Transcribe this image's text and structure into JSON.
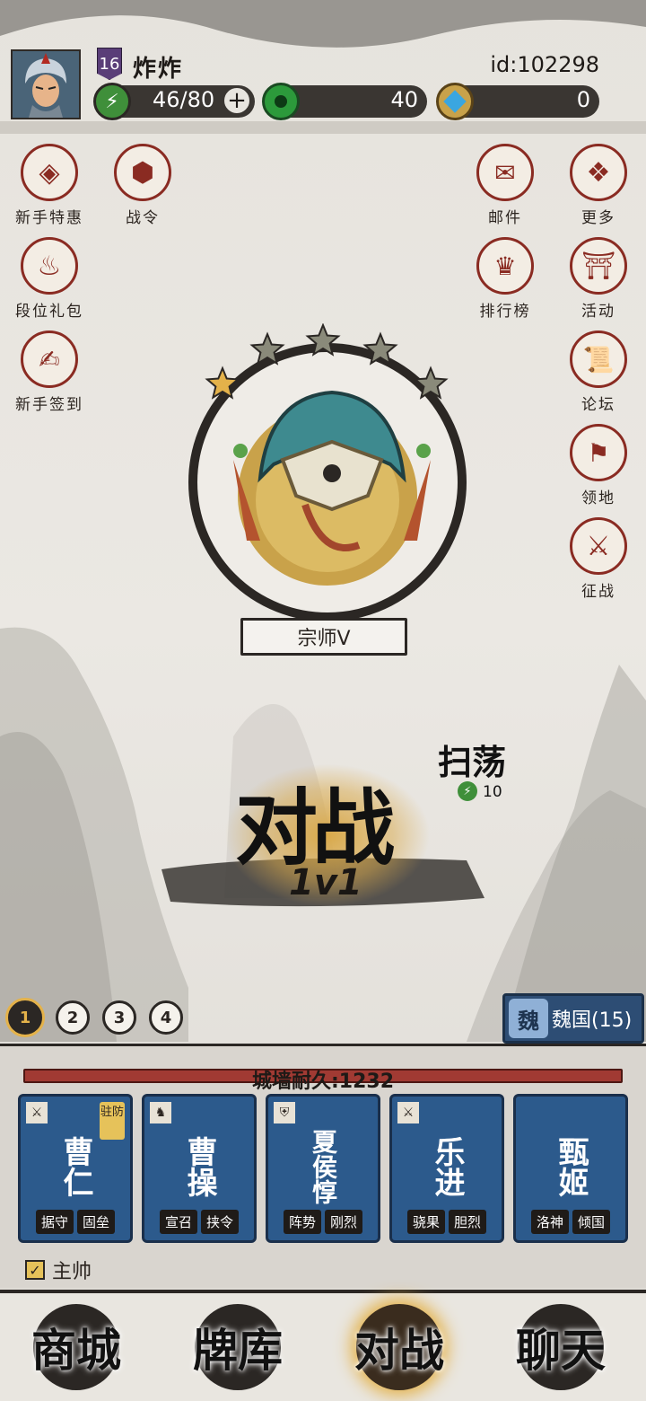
{
  "player": {
    "level": "16",
    "name": "炸炸",
    "id": "id:102298"
  },
  "resources": {
    "energy": "46/80",
    "jade": "40",
    "gems": "0"
  },
  "left_menu": [
    {
      "label": "新手特惠",
      "icon": "money-bag-icon"
    },
    {
      "label": "战令",
      "icon": "battle-pass-icon"
    },
    {
      "label": "段位礼包",
      "icon": "rank-gift-icon"
    },
    {
      "label": "新手签到",
      "icon": "sign-in-icon"
    }
  ],
  "right_menu": [
    {
      "label": "邮件",
      "icon": "mail-icon"
    },
    {
      "label": "更多",
      "icon": "more-icon"
    },
    {
      "label": "排行榜",
      "icon": "leaderboard-icon"
    },
    {
      "label": "活动",
      "icon": "event-icon"
    },
    {
      "label": "论坛",
      "icon": "forum-icon"
    },
    {
      "label": "领地",
      "icon": "territory-icon"
    },
    {
      "label": "征战",
      "icon": "campaign-icon"
    }
  ],
  "rank": {
    "name": "宗师V",
    "stars_total": 5,
    "stars_filled": 1
  },
  "battle": {
    "title": "对战",
    "mode": "1v1"
  },
  "sweep": {
    "label": "扫荡",
    "cost": "10"
  },
  "faction": {
    "char": "魏",
    "label": "魏国(15)"
  },
  "wall": {
    "label": "城墙耐久:1232"
  },
  "cards": [
    {
      "name": "曹仁",
      "tag": "驻防",
      "skills": [
        "据守",
        "固垒"
      ]
    },
    {
      "name": "曹操",
      "skills": [
        "宣召",
        "挟令"
      ]
    },
    {
      "name": "夏侯惇",
      "skills": [
        "阵势",
        "刚烈"
      ]
    },
    {
      "name": "乐进",
      "skills": [
        "骁果",
        "胆烈"
      ]
    },
    {
      "name": "甄姬",
      "skills": [
        "洛神",
        "倾国"
      ]
    }
  ],
  "commander": {
    "label": "主帅"
  },
  "nav": [
    "商城",
    "牌库",
    "对战",
    "聊天"
  ],
  "colors": {
    "accent_red": "#8a2b22",
    "faction_blue": "#2c5a8c",
    "gold": "#e4b24a"
  }
}
